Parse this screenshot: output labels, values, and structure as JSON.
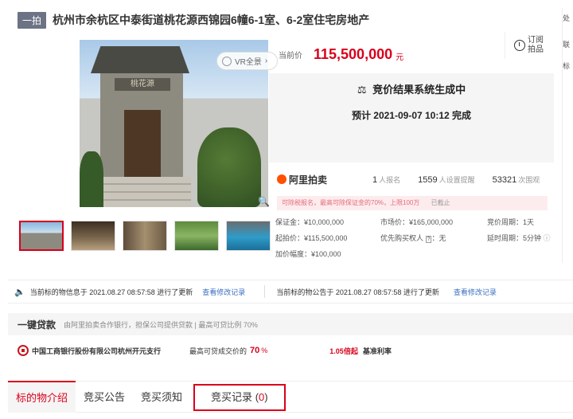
{
  "header": {
    "tag": "一拍",
    "title": "杭州市余杭区中泰街道桃花源西锦园6幢6-1室、6-2室住宅房地产"
  },
  "gallery": {
    "plaque": "桃花源",
    "vr_label": "VR全景",
    "thumbnails": [
      "gate",
      "interior",
      "hall",
      "garden",
      "pool"
    ]
  },
  "price": {
    "label": "当前价",
    "value": "115,500,000",
    "unit": "元"
  },
  "subscribe": {
    "line1": "订阅",
    "line2": "拍品"
  },
  "result": {
    "title": "竞价结果系统生成中",
    "time": "预计 2021-09-07 10:12 完成"
  },
  "stats": {
    "brand": "阿里拍卖",
    "signups": "1",
    "signups_label": "人报名",
    "reminders": "1559",
    "reminders_label": "人设置提醒",
    "views": "53321",
    "views_label": "次围观"
  },
  "notice": {
    "text": "可除税报名，最高可除保证金的70%，上限100万",
    "status": "已截止"
  },
  "info": {
    "deposit": "保证金：¥10,000,000",
    "market": "市场价：¥165,000,000",
    "cycle": "竞价周期：1天",
    "start": "起拍价：¥115,500,000",
    "priority_label": "优先购买权人",
    "priority_value": "无",
    "delay": "延时周期：5分钟",
    "increment": "加价幅度：¥100,000"
  },
  "right_strip": [
    "处",
    "联",
    "标"
  ],
  "updates": {
    "item_info": "当前标的物信息于 2021.08.27 08:57:58 进行了更新",
    "item_link": "查看修改记录",
    "notice_info": "当前标的物公告于 2021.08.27 08:57:58 进行了更新",
    "notice_link": "查看修改记录"
  },
  "loan": {
    "title": "一键贷款",
    "desc": "由阿里拍卖合作银行，担保公司提供贷款 | 最高可贷比例 70%",
    "bank": "中国工商银行股份有限公司杭州开元支行",
    "ratio_label": "最高可贷成交价的",
    "ratio": "70",
    "ratio_unit": "%",
    "times": "1.05倍起",
    "benchmark": "基准利率"
  },
  "tabs": {
    "intro": "标的物介绍",
    "announcement": "竞买公告",
    "terms": "竞买须知",
    "records": "竞买记录",
    "records_count": "0"
  }
}
